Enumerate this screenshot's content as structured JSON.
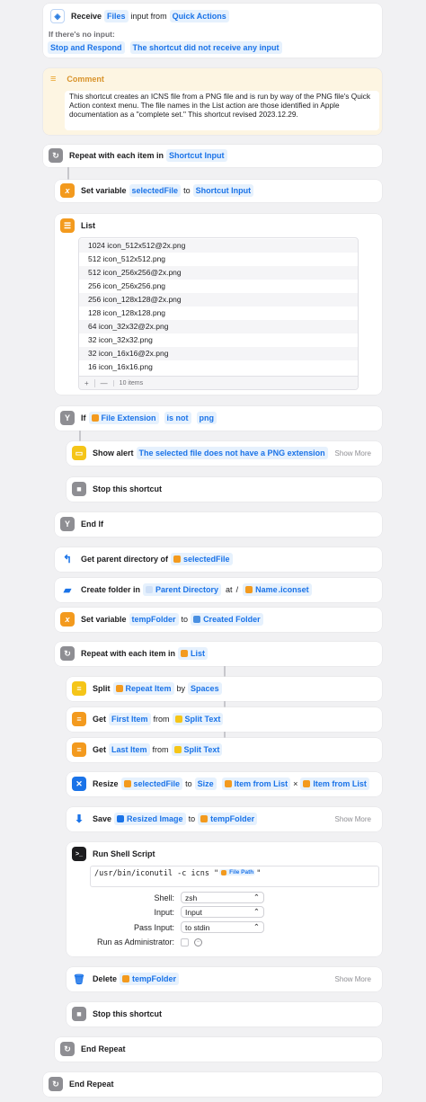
{
  "receive": {
    "label": "Receive",
    "input_type": "Files",
    "input_from": "input from",
    "source": "Quick Actions",
    "no_input_label": "If there's no input:",
    "stop_label": "Stop and Respond",
    "message": "The shortcut did not receive any input"
  },
  "comment": {
    "title": "Comment",
    "text": "This shortcut creates an ICNS file from a PNG file and is run by way of the PNG file's Quick Action context menu. The file names in the List action are those identified in Apple documentation as a \"complete set.\" This shortcut revised 2023.12.29."
  },
  "repeat1": {
    "label": "Repeat with each item in",
    "token": "Shortcut Input"
  },
  "setvar1": {
    "label": "Set variable",
    "var": "selectedFile",
    "to": "to",
    "token": "Shortcut Input"
  },
  "list": {
    "title": "List",
    "items": [
      "1024 icon_512x512@2x.png",
      "512 icon_512x512.png",
      "512 icon_256x256@2x.png",
      "256 icon_256x256.png",
      "256 icon_128x128@2x.png",
      "128 icon_128x128.png",
      "64 icon_32x32@2x.png",
      "32 icon_32x32.png",
      "32 icon_16x16@2x.png",
      "16 icon_16x16.png"
    ],
    "add": "+",
    "remove": "—",
    "count": "10 items"
  },
  "if": {
    "label": "If",
    "subject": "File Extension",
    "cond": "is not",
    "value": "png"
  },
  "alert": {
    "label": "Show alert",
    "message": "The selected file does not have a PNG extension",
    "more": "Show More"
  },
  "stop1": {
    "label": "Stop this shortcut"
  },
  "endif": {
    "label": "End If"
  },
  "getparent": {
    "label": "Get parent directory of",
    "token": "selectedFile"
  },
  "createfolder": {
    "label": "Create folder in",
    "token1": "Parent Directory",
    "at": "at",
    "slash": "/",
    "token2": "Name",
    "suffix": ".iconset"
  },
  "setvar2": {
    "label": "Set variable",
    "var": "tempFolder",
    "to": "to",
    "token": "Created Folder"
  },
  "repeat2": {
    "label": "Repeat with each item in",
    "token": "List"
  },
  "split": {
    "label": "Split",
    "token": "Repeat Item",
    "by": "by",
    "sep": "Spaces"
  },
  "get1": {
    "label": "Get",
    "what": "First Item",
    "from": "from",
    "token": "Split Text"
  },
  "get2": {
    "label": "Get",
    "what": "Last Item",
    "from": "from",
    "token": "Split Text"
  },
  "resize": {
    "label": "Resize",
    "token": "selectedFile",
    "to": "to",
    "size": "Size",
    "w": "Item from List",
    "x": "×",
    "h": "Item from List"
  },
  "save": {
    "label": "Save",
    "token": "Resized Image",
    "to": "to",
    "dest": "tempFolder",
    "more": "Show More"
  },
  "shell": {
    "title": "Run Shell Script",
    "script_pre": "/usr/bin/iconutil -c icns \"",
    "script_token": "File Path",
    "script_post": "\"",
    "shell_label": "Shell:",
    "shell_val": "zsh",
    "input_label": "Input:",
    "input_val": "Input",
    "pass_label": "Pass Input:",
    "pass_val": "to stdin",
    "admin_label": "Run as Administrator:"
  },
  "delete": {
    "label": "Delete",
    "token": "tempFolder",
    "more": "Show More"
  },
  "stop2": {
    "label": "Stop this shortcut"
  },
  "endrepeat1": {
    "label": "End Repeat"
  },
  "endrepeat2": {
    "label": "End Repeat"
  },
  "colors": {
    "accent": "#1a73e8",
    "orange": "#f4a02a",
    "gray": "#8e8e93"
  }
}
